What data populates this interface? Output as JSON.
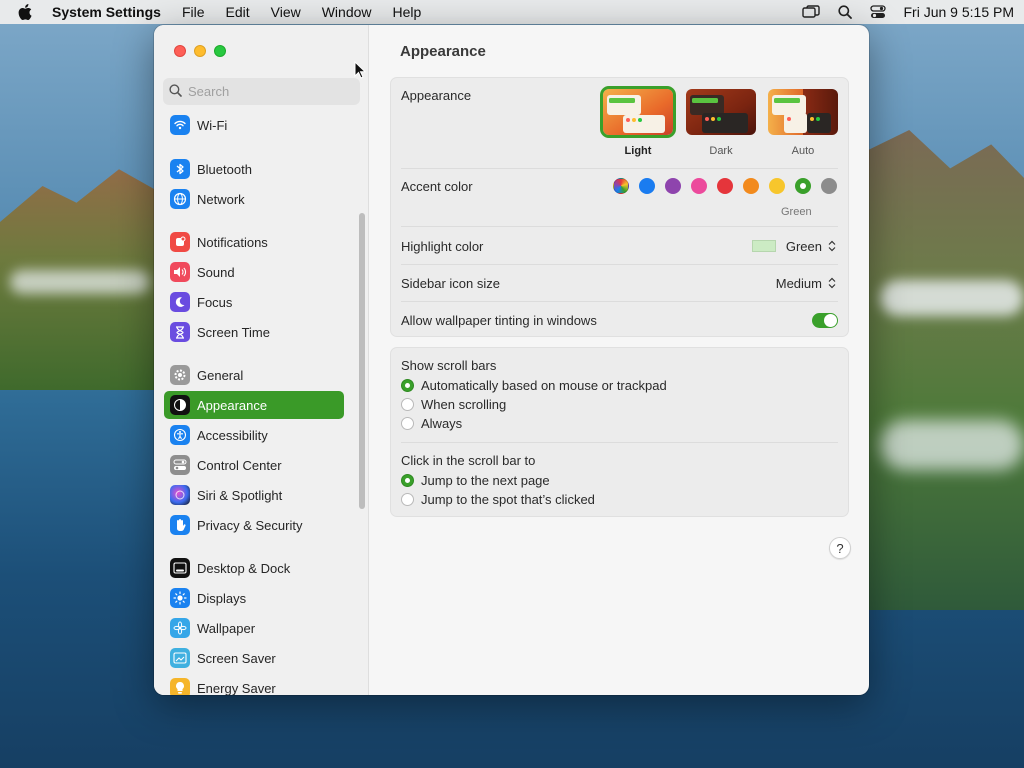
{
  "menubar": {
    "app_name": "System Settings",
    "items": [
      "File",
      "Edit",
      "View",
      "Window",
      "Help"
    ],
    "clock": "Fri Jun 9  5:15 PM"
  },
  "sidebar": {
    "search_placeholder": "Search",
    "items": [
      {
        "label": "Wi-Fi",
        "icon": "wifi-icon",
        "color": "#1a82f0"
      },
      {
        "label": "Bluetooth",
        "icon": "bluetooth-icon",
        "color": "#1a82f0"
      },
      {
        "label": "Network",
        "icon": "globe-icon",
        "color": "#1a82f0"
      },
      {
        "label": "Notifications",
        "icon": "bell-icon",
        "color": "#f04a44"
      },
      {
        "label": "Sound",
        "icon": "speaker-icon",
        "color": "#f04a5c"
      },
      {
        "label": "Focus",
        "icon": "moon-icon",
        "color": "#6a4ce0"
      },
      {
        "label": "Screen Time",
        "icon": "hourglass-icon",
        "color": "#6a4ce0"
      },
      {
        "label": "General",
        "icon": "gear-icon",
        "color": "#9a9a9a"
      },
      {
        "label": "Appearance",
        "icon": "appearance-icon",
        "color": "#111111",
        "active": true
      },
      {
        "label": "Accessibility",
        "icon": "accessibility-icon",
        "color": "#1a82f0"
      },
      {
        "label": "Control Center",
        "icon": "control-center-icon",
        "color": "#8e8e8e"
      },
      {
        "label": "Siri & Spotlight",
        "icon": "siri-icon",
        "color": "#7a3fb8"
      },
      {
        "label": "Privacy & Security",
        "icon": "hand-icon",
        "color": "#1a82f0"
      },
      {
        "label": "Desktop & Dock",
        "icon": "dock-icon",
        "color": "#111111"
      },
      {
        "label": "Displays",
        "icon": "sun-icon",
        "color": "#1a82f0"
      },
      {
        "label": "Wallpaper",
        "icon": "flower-icon",
        "color": "#35a6e8"
      },
      {
        "label": "Screen Saver",
        "icon": "screensaver-icon",
        "color": "#3fb0e0"
      },
      {
        "label": "Energy Saver",
        "icon": "bulb-icon",
        "color": "#f5b52a"
      }
    ]
  },
  "main": {
    "title": "Appearance",
    "appearance": {
      "label": "Appearance",
      "options": [
        {
          "label": "Light",
          "selected": true
        },
        {
          "label": "Dark",
          "selected": false
        },
        {
          "label": "Auto",
          "selected": false
        }
      ]
    },
    "accent": {
      "label": "Accent color",
      "colors": [
        "multicolor",
        "#1a7cf0",
        "#8e44ad",
        "#ec4a9c",
        "#e5353b",
        "#f28a1d",
        "#f7c62c",
        "#3aa02b",
        "#8c8c8c"
      ],
      "selected_index": 7,
      "selected_name": "Green"
    },
    "highlight": {
      "label": "Highlight color",
      "value": "Green",
      "swatch": "#ccebc4"
    },
    "icon_size": {
      "label": "Sidebar icon size",
      "value": "Medium"
    },
    "tinting": {
      "label": "Allow wallpaper tinting in windows",
      "on": true
    },
    "scroll_bars": {
      "label": "Show scroll bars",
      "options": [
        "Automatically based on mouse or trackpad",
        "When scrolling",
        "Always"
      ],
      "selected_index": 0
    },
    "click_scroll": {
      "label": "Click in the scroll bar to",
      "options": [
        "Jump to the next page",
        "Jump to the spot that’s clicked"
      ],
      "selected_index": 0
    },
    "help_label": "?"
  },
  "colors": {
    "accent": "#3aa02b"
  }
}
